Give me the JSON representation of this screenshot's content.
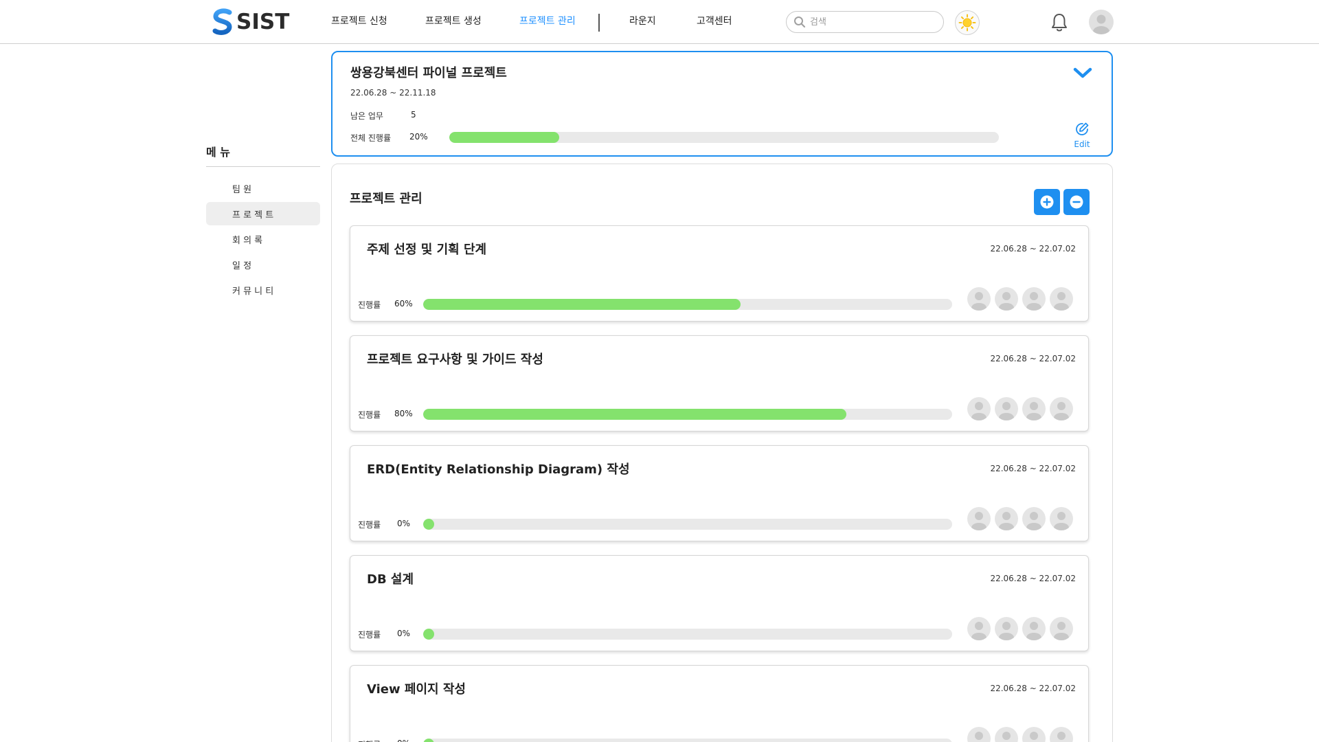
{
  "header": {
    "logo_text": "SIST",
    "nav": [
      {
        "label": "프로젝트 신청",
        "active": false
      },
      {
        "label": "프로젝트 생성",
        "active": false
      },
      {
        "label": "프로젝트 관리",
        "active": true
      },
      {
        "label": "라운지",
        "active": false
      },
      {
        "label": "고객센터",
        "active": false
      }
    ],
    "search_placeholder": "검색",
    "accent_color": "#1e8ff0"
  },
  "sidebar": {
    "title": "메 뉴",
    "items": [
      {
        "label": "팀 원",
        "active": false
      },
      {
        "label": "프 로 젝 트",
        "active": true
      },
      {
        "label": "회 의 록",
        "active": false
      },
      {
        "label": "일 정",
        "active": false
      },
      {
        "label": "커 뮤 니 티",
        "active": false
      }
    ]
  },
  "summary": {
    "title": "쌍용강북센터 파이널 프로젝트",
    "date_range": "22.06.28 ~ 22.11.18",
    "remaining_label": "남은 업무",
    "remaining_value": "5",
    "progress_label": "전체 진행률",
    "progress_text": "20%",
    "progress_fraction": 0.2,
    "edit_label": "Edit"
  },
  "panel": {
    "title": "프로젝트 관리",
    "progress_label": "진행률",
    "tasks": [
      {
        "title": "주제 선정 및 기획 단계",
        "date_range": "22.06.28 ~ 22.07.02",
        "progress_text": "60%",
        "progress_fraction": 0.6
      },
      {
        "title": "프로젝트 요구사항 및  가이드 작성",
        "date_range": "22.06.28 ~ 22.07.02",
        "progress_text": "80%",
        "progress_fraction": 0.8
      },
      {
        "title": "ERD(Entity Relationship Diagram) 작성",
        "date_range": "22.06.28 ~ 22.07.02",
        "progress_text": "0%",
        "progress_fraction": 0
      },
      {
        "title": "DB 설계",
        "date_range": "22.06.28 ~ 22.07.02",
        "progress_text": "0%",
        "progress_fraction": 0
      },
      {
        "title": "View 페이지 작성",
        "date_range": "22.06.28 ~ 22.07.02",
        "progress_text": "0%",
        "progress_fraction": 0
      }
    ]
  },
  "colors": {
    "progress_fill": "#84e26d",
    "progress_track": "#e9e9e9",
    "accent": "#1e8ff0"
  }
}
